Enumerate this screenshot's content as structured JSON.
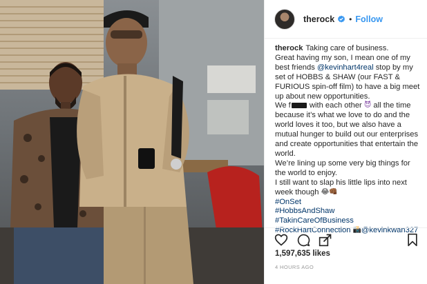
{
  "post": {
    "header": {
      "username": "therock",
      "verified_icon": "verified-badge-icon",
      "separator": "•",
      "follow_label": "Follow"
    },
    "caption": {
      "username": "therock",
      "line1": "Taking care of business.",
      "line2a": "Great having my son, I mean one of my best friends ",
      "mention_kevin": "@kevinhart4real",
      "line2b": " stop by my set of HOBBS & SHAW (our FAST & FURIOUS spin-off film) to have a big meet up about new opportunities.",
      "line3a": "We f",
      "line3b": " with each other ",
      "devil_emoji": "😈",
      "line3c": " all the time because it’s what we love to do and the world loves it too, but we also have a mutual hunger to build out our enterprises and create opportunities that entertain the world.",
      "line4": "We’re lining up some very big things for the world to enjoy.",
      "line5": "I still want to slap his little lips into next week though ",
      "line5_emoji": "😂👊🏾",
      "hashtags": [
        "#OnSet",
        "#HobbsAndShaw",
        "#TakinCareOfBusiness",
        "#RockHartConnection"
      ],
      "camera_emoji": "📸",
      "mention_photographer": "@kevinkwan327"
    },
    "likes": "1,597,635 likes",
    "timestamp": "4 HOURS AGO"
  },
  "colors": {
    "link_blue": "#3897f0",
    "tag_blue": "#003569",
    "text": "#262626",
    "muted": "#999999",
    "divider": "#efefef"
  },
  "icons": [
    "heart-icon",
    "comment-icon",
    "share-icon",
    "bookmark-icon",
    "verified-badge-icon"
  ]
}
